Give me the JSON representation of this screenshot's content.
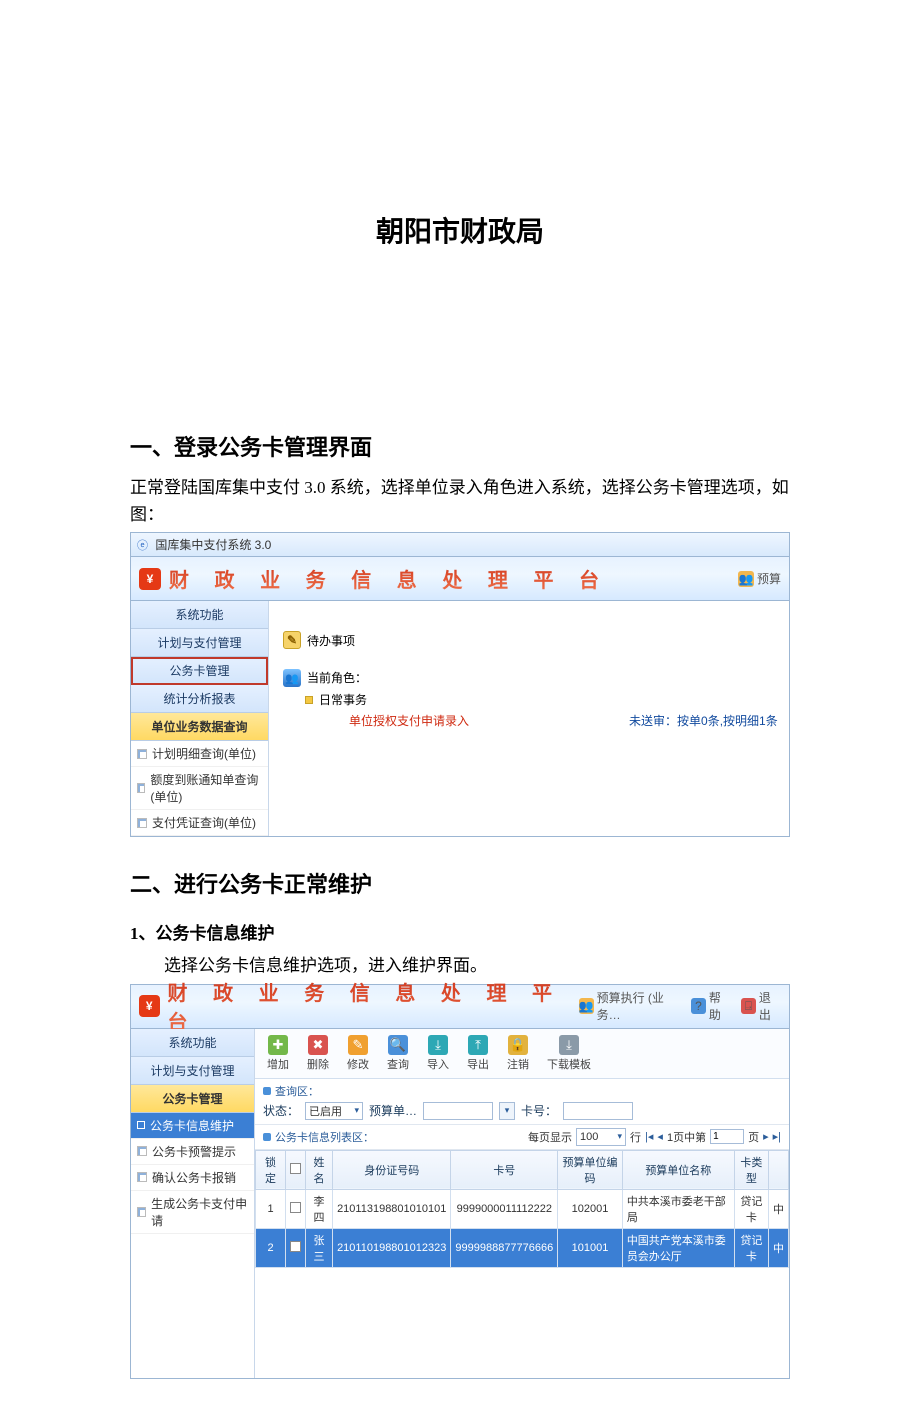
{
  "doc_title": "朝阳市财政局",
  "s1": {
    "heading": "一、登录公务卡管理界面",
    "para": "正常登陆国库集中支付 3.0 系统，选择单位录入角色进入系统，选择公务卡管理选项，如图："
  },
  "app1": {
    "window_title": "国库集中支付系统 3.0",
    "banner_text": "财 政 业 务 信 息 处 理 平 台",
    "banner_right_btn": "预算",
    "nav": {
      "items": [
        "系统功能",
        "计划与支付管理",
        "公务卡管理",
        "统计分析报表",
        "单位业务数据查询"
      ],
      "highlight_index": 2,
      "yellow_index": 4,
      "sub_items": [
        "计划明细查询(单位)",
        "额度到账通知单查询(单位)",
        "支付凭证查询(单位)"
      ]
    },
    "content": {
      "pending_label": "待办事项",
      "role_label": "当前角色：",
      "role_task": "日常事务",
      "link_red": "单位授权支付申请录入",
      "link_blue": "未送审：按单0条,按明细1条"
    }
  },
  "s2": {
    "heading": "二、进行公务卡正常维护"
  },
  "s2_1": {
    "heading": "1、公务卡信息维护",
    "para": "选择公务卡信息维护选项，进入维护界面。"
  },
  "app2": {
    "banner_text": "财 政 业 务 信 息 处 理 平 台",
    "banner_right": {
      "b1": "预算执行 (业务…",
      "b2": "帮助",
      "b3": "退出"
    },
    "nav": {
      "top": [
        "系统功能",
        "计划与支付管理",
        "公务卡管理"
      ],
      "sub": [
        "公务卡信息维护",
        "公务卡预警提示",
        "确认公务卡报销",
        "生成公务卡支付申请"
      ],
      "sel_index": 0
    },
    "toolbar": [
      {
        "label": "增加",
        "cls": "ic-green",
        "sym": "✚"
      },
      {
        "label": "删除",
        "cls": "ic-red",
        "sym": "✖"
      },
      {
        "label": "修改",
        "cls": "ic-orange",
        "sym": "✎"
      },
      {
        "label": "查询",
        "cls": "ic-blue",
        "sym": "🔍"
      },
      {
        "label": "导入",
        "cls": "ic-cyan",
        "sym": "⤓"
      },
      {
        "label": "导出",
        "cls": "ic-cyan",
        "sym": "⤒"
      },
      {
        "label": "注销",
        "cls": "ic-gold",
        "sym": "🔒"
      },
      {
        "label": "下载模板",
        "cls": "ic-gray",
        "sym": "⤓"
      }
    ],
    "filter": {
      "area_title": "查询区：",
      "state_label": "状态：",
      "state_value": "已启用",
      "budget_label": "预算单…",
      "card_label": "卡号："
    },
    "list_title": "公务卡信息列表区：",
    "pager": {
      "per_page_label": "每页显示",
      "per_page": "100",
      "rows_label": "行",
      "page_of_1": "1页中第",
      "page_cur": "1",
      "page_of_2": "页"
    },
    "columns": [
      "锁定",
      "",
      "姓名",
      "身份证号码",
      "卡号",
      "预算单位编码",
      "预算单位名称",
      "卡类型",
      ""
    ],
    "rows": [
      {
        "idx": "1",
        "name": "李四",
        "id": "210113198801010101",
        "card": "9999000011112222",
        "orgcode": "102001",
        "orgname": "中共本溪市委老干部局",
        "type": "贷记卡",
        "t": "中"
      },
      {
        "idx": "2",
        "name": "张三",
        "id": "210110198801012323",
        "card": "9999988877776666",
        "orgcode": "101001",
        "orgname": "中国共产党本溪市委员会办公厅",
        "type": "贷记卡",
        "t": "中"
      }
    ]
  }
}
